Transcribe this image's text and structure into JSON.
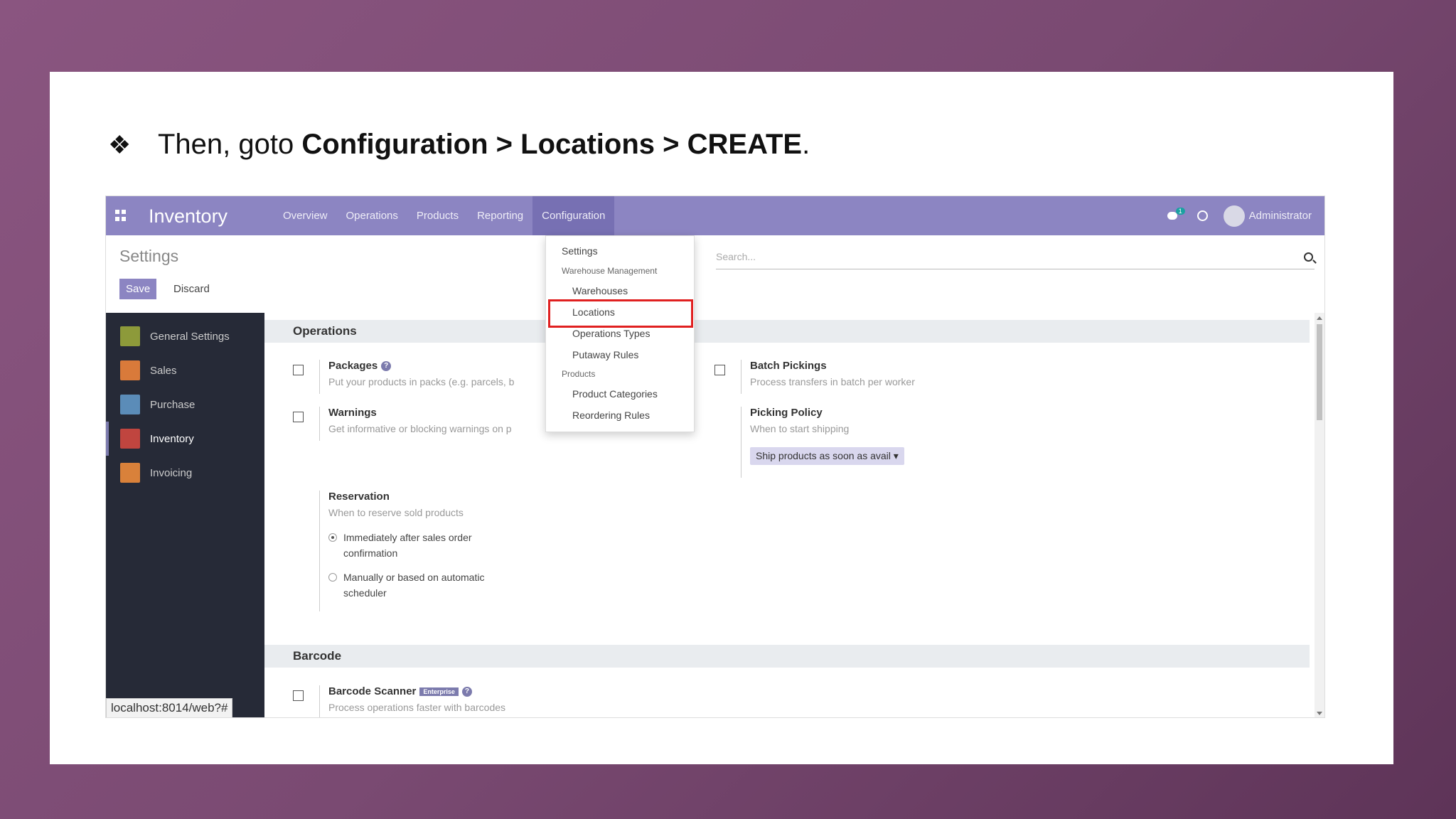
{
  "slide": {
    "bullet": "❖",
    "text_prefix": "Then, goto ",
    "text_bold": "Configuration > Locations > CREATE",
    "text_suffix": "."
  },
  "navbar": {
    "app_title": "Inventory",
    "menu": [
      "Overview",
      "Operations",
      "Products",
      "Reporting",
      "Configuration"
    ],
    "active_menu": "Configuration",
    "chat_badge": "1",
    "user_name": "Administrator"
  },
  "control": {
    "title": "Settings",
    "save_label": "Save",
    "discard_label": "Discard",
    "search_placeholder": "Search..."
  },
  "sidebar": {
    "items": [
      {
        "label": "General Settings",
        "icon": "gear-icon",
        "color": "#8d9a3a"
      },
      {
        "label": "Sales",
        "icon": "chart-icon",
        "color": "#d97a3a"
      },
      {
        "label": "Purchase",
        "icon": "credit-card-icon",
        "color": "#5b8cb8"
      },
      {
        "label": "Inventory",
        "icon": "box-icon",
        "color": "#c0453f"
      },
      {
        "label": "Invoicing",
        "icon": "invoice-icon",
        "color": "#d9813a"
      }
    ],
    "active": "Inventory",
    "status_url": "localhost:8014/web?#"
  },
  "content": {
    "operations_header": "Operations",
    "packages_title": "Packages",
    "packages_desc": "Put your products in packs (e.g. parcels, b",
    "warnings_title": "Warnings",
    "warnings_desc": "Get informative or blocking warnings on p",
    "batch_title": "Batch Pickings",
    "batch_desc": "Process transfers in batch per worker",
    "picking_title": "Picking Policy",
    "picking_desc": "When to start shipping",
    "picking_value": "Ship products as soon as avail",
    "reservation_title": "Reservation",
    "reservation_desc": "When to reserve sold products",
    "reservation_opt1": "Immediately after sales order confirmation",
    "reservation_opt2": "Manually or based on automatic scheduler",
    "barcode_header": "Barcode",
    "barcode_title": "Barcode Scanner",
    "barcode_badge": "Enterprise",
    "barcode_desc": "Process operations faster with barcodes"
  },
  "dropdown": {
    "settings": "Settings",
    "warehouse_mgmt": "Warehouse Management",
    "warehouses": "Warehouses",
    "locations": "Locations",
    "operation_types": "Operations Types",
    "putaway_rules": "Putaway Rules",
    "products_head": "Products",
    "product_categories": "Product Categories",
    "reordering_rules": "Reordering Rules"
  }
}
